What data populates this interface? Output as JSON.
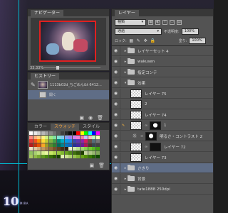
{
  "navigator": {
    "tab_label": "ナビゲーター",
    "zoom_percent": "33.33%"
  },
  "history": {
    "tab_label": "ヒストリー",
    "snapshot_label": "1113b02d_ちごめん&t 6412...",
    "state_label": "開く"
  },
  "swatches": {
    "tabs": [
      "カラー",
      "スウォッチ",
      "スタイル"
    ],
    "colors": [
      "#ffffff",
      "#e8e8e8",
      "#d0d0d0",
      "#b8b8b8",
      "#a0a0a0",
      "#888888",
      "#707070",
      "#585858",
      "#404040",
      "#282828",
      "#101010",
      "#000000",
      "#ff0000",
      "#ffff00",
      "#00ff00",
      "#00ffff",
      "#0000ff",
      "#ff00ff",
      "#ff8a80",
      "#ffb080",
      "#ffd080",
      "#fff080",
      "#d0f080",
      "#a0e880",
      "#80e0a0",
      "#80e0d0",
      "#80c8f0",
      "#80a0f0",
      "#a080f0",
      "#d080f0",
      "#f080d0",
      "#f080a0",
      "#c0c0ff",
      "#ffc0c0",
      "#c0ffc0",
      "#ffffc0",
      "#e53935",
      "#f4511e",
      "#fb8c00",
      "#fdd835",
      "#c0ca33",
      "#7cb342",
      "#43a047",
      "#00897b",
      "#00acc1",
      "#039be5",
      "#1e88e5",
      "#3949ab",
      "#5e35b1",
      "#8e24aa",
      "#d81b60",
      "#6d4c41",
      "#546e7a",
      "#757575",
      "#b71c1c",
      "#bf360c",
      "#e65100",
      "#f9a825",
      "#9e9d24",
      "#558b2f",
      "#2e7d32",
      "#00695c",
      "#00838f",
      "#0277bd",
      "#1565c0",
      "#283593",
      "#4527a0",
      "#6a1b9a",
      "#ad1457",
      "#4e342e",
      "#37474f",
      "#424242",
      "#f0e0c0",
      "#e0c8a0",
      "#d0b080",
      "#c09860",
      "#a88048",
      "#906838",
      "#785028",
      "#604020",
      "#483018",
      "#302010",
      "#e8f0d0",
      "#d0e8b0",
      "#b8e090",
      "#a0d870",
      "#88d050",
      "#70c830",
      "#58b820",
      "#40a010",
      "#90c060",
      "#a8d070",
      "#c0e080",
      "#d8f090",
      "#e8f8a0",
      "#c8e868",
      "#b0d850",
      "#98c840",
      "#80b830",
      "#68a020",
      "#508818",
      "#407010",
      "#305808",
      "#204000",
      "#c8d8a0",
      "#b0c888",
      "#98b870",
      "#80a858",
      "#a8c860",
      "#90b848",
      "#78a830",
      "#609820",
      "#488810",
      "#387008",
      "#285800",
      "#184000",
      "#e0f0b0",
      "#c8e090",
      "#b0d070",
      "#98c050",
      "#80b030",
      "#68a018",
      "#509000",
      "#387800",
      "#206000",
      "#104800"
    ]
  },
  "layers": {
    "tab_label": "レイヤー",
    "kind_filter": "種類",
    "blend_mode": "通過",
    "opacity_label": "不透明度:",
    "opacity_value": "100%",
    "lock_label": "ロック:",
    "fill_label": "塗り:",
    "fill_value": "100%",
    "items": [
      {
        "name": "レイヤーセット 4",
        "kind": "group",
        "indent": 0,
        "selected": false
      },
      {
        "name": "wakusen",
        "kind": "group",
        "indent": 0,
        "selected": false
      },
      {
        "name": "指定コンテ",
        "kind": "group",
        "indent": 0,
        "selected": false
      },
      {
        "name": "効果",
        "kind": "group-open",
        "indent": 0,
        "selected": false
      },
      {
        "name": "レイヤー 75",
        "kind": "pixel",
        "indent": 1,
        "selected": false
      },
      {
        "name": "2",
        "kind": "pixel",
        "indent": 1,
        "selected": false
      },
      {
        "name": "レイヤー 74",
        "kind": "pixel",
        "indent": 1,
        "selected": false
      },
      {
        "name": "1",
        "kind": "masked",
        "indent": 1,
        "selected": false
      },
      {
        "name": "明るさ・コントラスト 2",
        "kind": "adjustment",
        "indent": 1,
        "selected": false
      },
      {
        "name": "レイヤー 72",
        "kind": "masked-dark",
        "indent": 1,
        "selected": false
      },
      {
        "name": "レイヤー 73",
        "kind": "pixel",
        "indent": 1,
        "selected": false
      },
      {
        "name": "さきり",
        "kind": "group",
        "indent": 0,
        "selected": true
      },
      {
        "name": "背景",
        "kind": "group",
        "indent": 0,
        "selected": false
      },
      {
        "name": "tate1888 250dpi",
        "kind": "group",
        "indent": 0,
        "selected": false
      }
    ]
  },
  "logo": {
    "number": "10",
    "subtitle": "MIRA"
  }
}
